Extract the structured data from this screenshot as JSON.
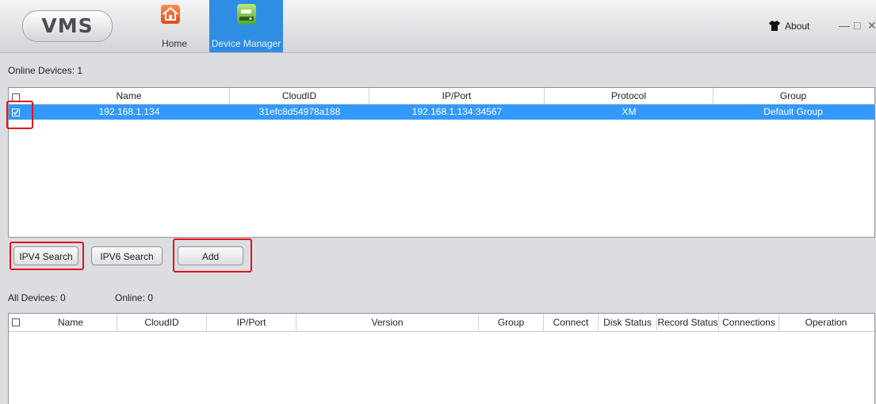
{
  "app": {
    "logo_text": "VMS"
  },
  "nav": {
    "home_label": "Home",
    "device_manager_label": "Device Manager"
  },
  "window": {
    "about_label": "About",
    "minimize": "—",
    "maximize": "□",
    "close": "✕"
  },
  "online": {
    "count_label": "Online Devices:  1",
    "columns": [
      "Name",
      "CloudID",
      "IP/Port",
      "Protocol",
      "Group"
    ],
    "rows": [
      {
        "name": "192.168.1.134",
        "cloudid": "31efc8d54978a188",
        "ipport": "192.168.1.134:34567",
        "protocol": "XM",
        "group": "Default Group",
        "checked": true
      }
    ]
  },
  "buttons": {
    "ipv4": "IPV4 Search",
    "ipv6": "IPV6 Search",
    "add": "Add"
  },
  "all_devices": {
    "all_label": "All Devices:  0",
    "online_label": "Online:  0",
    "columns": [
      "Name",
      "CloudID",
      "IP/Port",
      "Version",
      "Group",
      "Connect",
      "Disk Status",
      "Record Status",
      "Connections",
      "Operation"
    ]
  },
  "colors": {
    "accent": "#2f8de4",
    "selection": "#3399ff",
    "highlight": "#e4121b"
  }
}
